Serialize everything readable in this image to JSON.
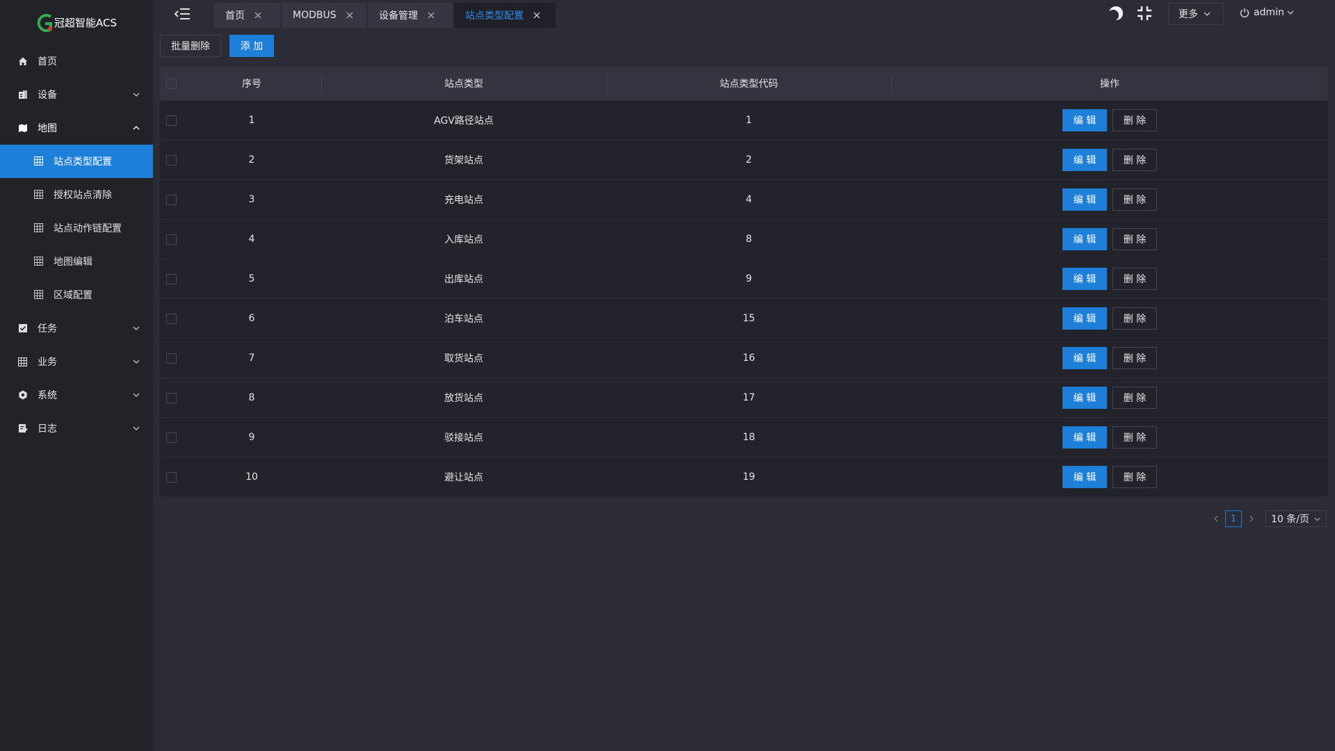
{
  "app": {
    "logo_text": "冠超智能ACS"
  },
  "sidebar": {
    "items": [
      {
        "label": "首页",
        "icon": "home-icon"
      },
      {
        "label": "设备",
        "icon": "device-icon"
      },
      {
        "label": "地图",
        "icon": "map-icon"
      },
      {
        "label": "任务",
        "icon": "task-icon"
      },
      {
        "label": "业务",
        "icon": "business-icon"
      },
      {
        "label": "系统",
        "icon": "settings-icon"
      },
      {
        "label": "日志",
        "icon": "log-icon"
      }
    ],
    "map_subitems": [
      {
        "label": "站点类型配置"
      },
      {
        "label": "授权站点清除"
      },
      {
        "label": "站点动作链配置"
      },
      {
        "label": "地图编辑"
      },
      {
        "label": "区域配置"
      }
    ]
  },
  "tabs": [
    {
      "label": "首页"
    },
    {
      "label": "MODBUS"
    },
    {
      "label": "设备管理"
    },
    {
      "label": "站点类型配置"
    }
  ],
  "header": {
    "more_label": "更多",
    "user_label": "admin"
  },
  "toolbar": {
    "batch_delete_label": "批量删除",
    "add_label": "添 加"
  },
  "table": {
    "columns": [
      "序号",
      "站点类型",
      "站点类型代码",
      "操作"
    ],
    "edit_label": "编 辑",
    "delete_label": "删 除",
    "rows": [
      {
        "index": "1",
        "type": "AGV路径站点",
        "code": "1"
      },
      {
        "index": "2",
        "type": "货架站点",
        "code": "2"
      },
      {
        "index": "3",
        "type": "充电站点",
        "code": "4"
      },
      {
        "index": "4",
        "type": "入库站点",
        "code": "8"
      },
      {
        "index": "5",
        "type": "出库站点",
        "code": "9"
      },
      {
        "index": "6",
        "type": "泊车站点",
        "code": "15"
      },
      {
        "index": "7",
        "type": "取货站点",
        "code": "16"
      },
      {
        "index": "8",
        "type": "放货站点",
        "code": "17"
      },
      {
        "index": "9",
        "type": "驳接站点",
        "code": "18"
      },
      {
        "index": "10",
        "type": "避让站点",
        "code": "19"
      }
    ]
  },
  "pagination": {
    "current_page": "1",
    "page_size_label": "10 条/页"
  },
  "colors": {
    "accent": "#1e7fd8",
    "sidebar_bg": "#222329",
    "page_bg": "#2b2c36"
  }
}
